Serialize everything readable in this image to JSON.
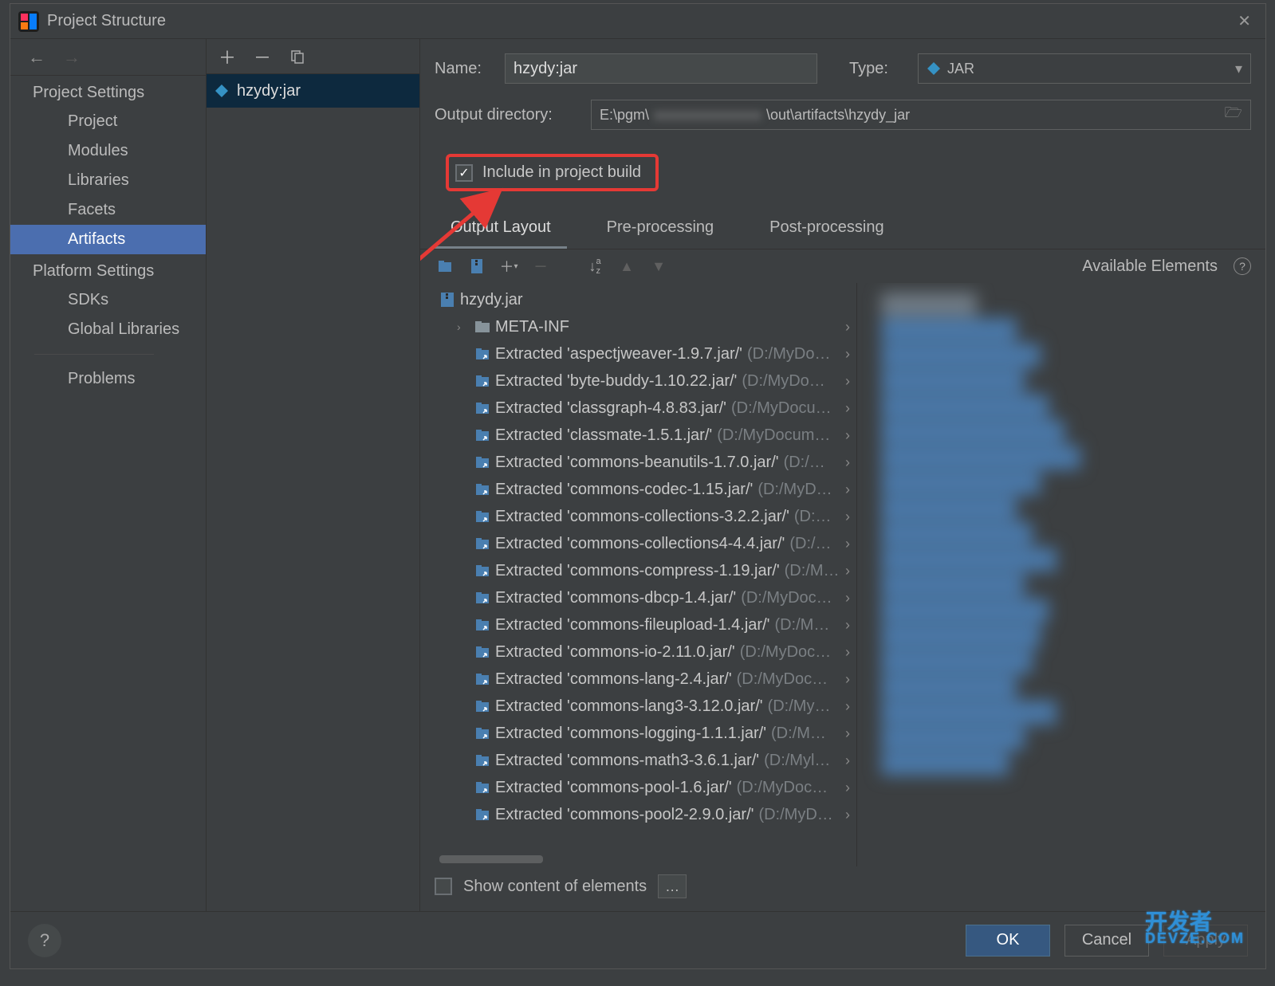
{
  "window": {
    "title": "Project Structure"
  },
  "nav": {
    "project_settings_label": "Project Settings",
    "platform_settings_label": "Platform Settings",
    "items": {
      "project": "Project",
      "modules": "Modules",
      "libraries": "Libraries",
      "facets": "Facets",
      "artifacts": "Artifacts",
      "sdks": "SDKs",
      "global_libraries": "Global Libraries",
      "problems": "Problems"
    }
  },
  "artifact_list": {
    "selected": "hzydy:jar"
  },
  "form": {
    "name_label": "Name:",
    "name_value": "hzydy:jar",
    "type_label": "Type:",
    "type_value": "JAR",
    "output_dir_label": "Output directory:",
    "output_dir_prefix": "E:\\pgm\\",
    "output_dir_blur": "xxxxxxxxxxxxxxx",
    "output_dir_suffix": "\\out\\artifacts\\hzydy_jar",
    "include_in_build_label": "Include in project build",
    "include_in_build_checked": true
  },
  "tabs": {
    "output_layout": "Output Layout",
    "pre_processing": "Pre-processing",
    "post_processing": "Post-processing"
  },
  "layout": {
    "available_elements_label": "Available Elements",
    "root_jar": "hzydy.jar",
    "meta_inf": "META-INF",
    "items": [
      {
        "name": "Extracted 'aspectjweaver-1.9.7.jar/'",
        "path": "(D:/MyDo…"
      },
      {
        "name": "Extracted 'byte-buddy-1.10.22.jar/'",
        "path": "(D:/MyDo…"
      },
      {
        "name": "Extracted 'classgraph-4.8.83.jar/'",
        "path": "(D:/MyDocu…"
      },
      {
        "name": "Extracted 'classmate-1.5.1.jar/'",
        "path": "(D:/MyDocum…"
      },
      {
        "name": "Extracted 'commons-beanutils-1.7.0.jar/'",
        "path": "(D:/…"
      },
      {
        "name": "Extracted 'commons-codec-1.15.jar/'",
        "path": "(D:/MyD…"
      },
      {
        "name": "Extracted 'commons-collections-3.2.2.jar/'",
        "path": "(D:…"
      },
      {
        "name": "Extracted 'commons-collections4-4.4.jar/'",
        "path": "(D:/…"
      },
      {
        "name": "Extracted 'commons-compress-1.19.jar/'",
        "path": "(D:/M…"
      },
      {
        "name": "Extracted 'commons-dbcp-1.4.jar/'",
        "path": "(D:/MyDoc…"
      },
      {
        "name": "Extracted 'commons-fileupload-1.4.jar/'",
        "path": "(D:/M…"
      },
      {
        "name": "Extracted 'commons-io-2.11.0.jar/'",
        "path": "(D:/MyDoc…"
      },
      {
        "name": "Extracted 'commons-lang-2.4.jar/'",
        "path": "(D:/MyDoc…"
      },
      {
        "name": "Extracted 'commons-lang3-3.12.0.jar/'",
        "path": "(D:/My…"
      },
      {
        "name": "Extracted 'commons-logging-1.1.1.jar/'",
        "path": "(D:/M…"
      },
      {
        "name": "Extracted 'commons-math3-3.6.1.jar/'",
        "path": "(D:/Myl…"
      },
      {
        "name": "Extracted 'commons-pool-1.6.jar/'",
        "path": "(D:/MyDoc…"
      },
      {
        "name": "Extracted 'commons-pool2-2.9.0.jar/'",
        "path": "(D:/MyD…"
      }
    ]
  },
  "show_content_label": "Show content of elements",
  "buttons": {
    "ok": "OK",
    "cancel": "Cancel",
    "apply": "Apply"
  },
  "watermark": {
    "line1": "开发者",
    "line2": "DEVZE.COM"
  }
}
